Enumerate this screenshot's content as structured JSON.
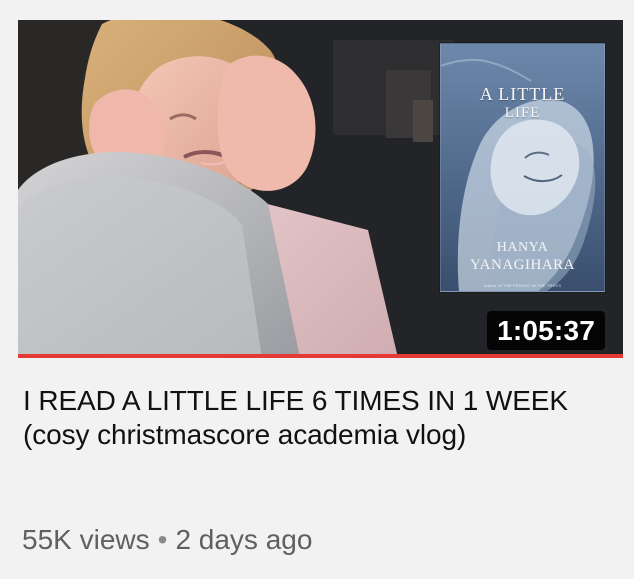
{
  "thumbnail": {
    "book": {
      "title_line1": "A LITTLE",
      "title_line2": "LIFE",
      "author_line1": "HANYA",
      "author_line2": "YANAGIHARA",
      "small_text": "Author of THE PEOPLE IN THE TREES"
    },
    "duration": "1:05:37",
    "watch_progress": 1.0,
    "progress_color": "#e53935"
  },
  "video": {
    "title_line1": "I READ A LITTLE LIFE 6 TIMES IN 1 WEEK",
    "title_line2": "(cosy christmascore academia vlog)"
  },
  "meta": {
    "views": "55K views",
    "separator": "•",
    "age": "2 days ago"
  },
  "colors": {
    "background": "#f2f2f2",
    "title_text": "#111111",
    "meta_text": "#606060"
  }
}
